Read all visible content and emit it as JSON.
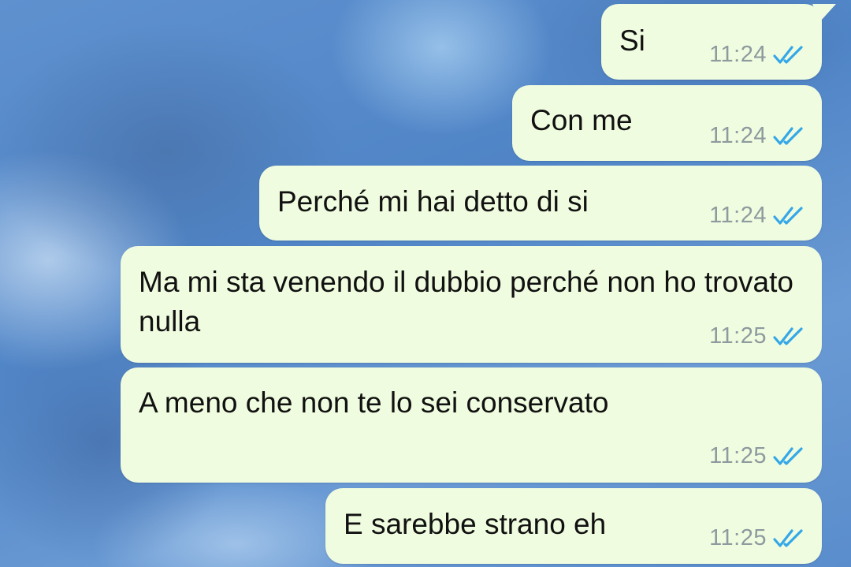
{
  "messages": [
    {
      "text": "Si",
      "time": "11:24",
      "status": "read"
    },
    {
      "text": "Con me",
      "time": "11:24",
      "status": "read"
    },
    {
      "text": "Perché mi hai detto di si",
      "time": "11:24",
      "status": "read"
    },
    {
      "text": "Ma mi sta venendo il dubbio perché non ho trovato nulla",
      "time": "11:25",
      "status": "read"
    },
    {
      "text": "A meno che non te lo sei conservato",
      "time": "11:25",
      "status": "read"
    },
    {
      "text": "E sarebbe strano eh",
      "time": "11:25",
      "status": "read"
    }
  ],
  "colors": {
    "bubble": "#f0fcdf",
    "read_ticks": "#34a7e8",
    "time_text": "#8d9a9e"
  },
  "icons": {
    "status": "double-check-icon"
  }
}
